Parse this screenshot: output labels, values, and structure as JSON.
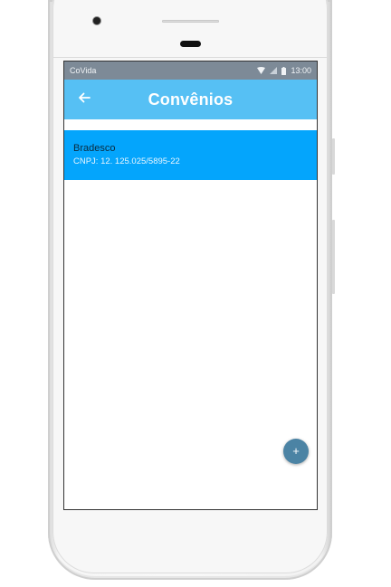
{
  "status_bar": {
    "carrier": "CoVida",
    "time": "13:00",
    "icons": [
      "wifi-icon",
      "signal-icon",
      "battery-icon"
    ]
  },
  "app_bar": {
    "title": "Convênios",
    "back_icon": "arrow-left-icon"
  },
  "list": {
    "items": [
      {
        "name": "Bradesco",
        "subtitle": "CNPJ: 12. 125.025/5895-22"
      }
    ]
  },
  "fab": {
    "label": "+",
    "icon": "plus-icon"
  },
  "colors": {
    "status_bar": "#7d8a97",
    "app_bar": "#56c0f4",
    "list_item": "#04a5fc",
    "fab": "#4b83a4"
  }
}
